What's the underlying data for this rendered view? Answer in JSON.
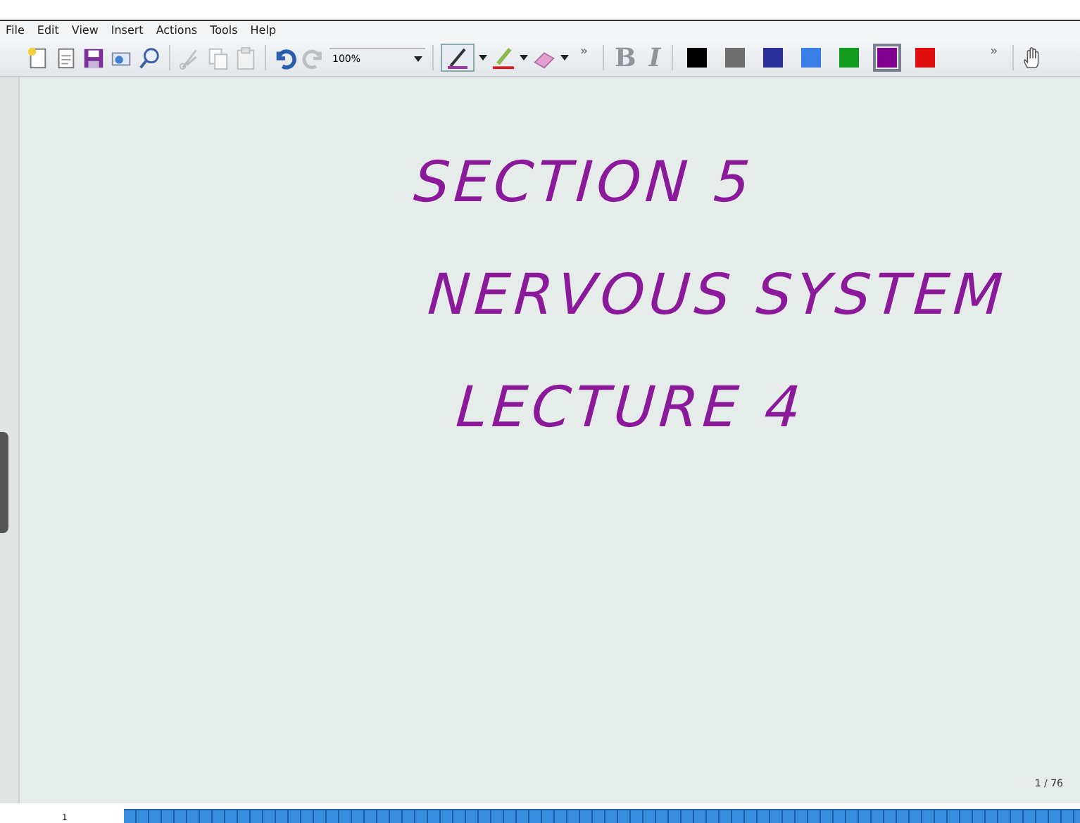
{
  "menu": [
    "File",
    "Edit",
    "View",
    "Insert",
    "Actions",
    "Tools",
    "Help"
  ],
  "toolbar": {
    "zoom": "100%",
    "more": "»",
    "bold": {
      "label": "B",
      "disabled": true
    },
    "italic": {
      "label": "I",
      "disabled": true
    },
    "colors": [
      {
        "color": "#000000",
        "selected": false
      },
      {
        "color": "#6e6e6e",
        "selected": false
      },
      {
        "color": "#2b2f9a",
        "selected": false
      },
      {
        "color": "#3a7ee8",
        "selected": false
      },
      {
        "color": "#119a1c",
        "selected": false
      },
      {
        "color": "#800090",
        "selected": true
      },
      {
        "color": "#e01010",
        "selected": false
      }
    ],
    "more_2": "»"
  },
  "ink": [
    "SECTION 5",
    "NERVOUS SYSTEM",
    "LECTURE 4"
  ],
  "page_indicator": "1 / 76",
  "page_label": "1"
}
